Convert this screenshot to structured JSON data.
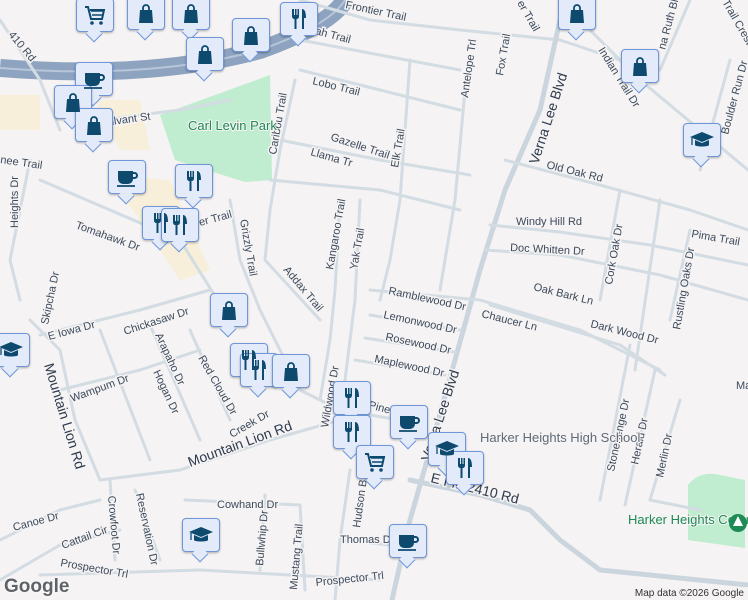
{
  "map": {
    "parks": [
      "Carl Levin Park",
      "Harker Heights Community Park"
    ],
    "poi": "Harker Heights High School",
    "roads": [
      "410 Rd",
      "Frontier Trail",
      "eetah Trail",
      "Lobo Trail",
      "Caribou Trail",
      "Gazelle Trail",
      "Llama Tr",
      "Elk Trail",
      "Antelope Trl",
      "Fox Trail",
      "er Trail",
      "Verna Lee Blvd",
      "Indian Trail Dr",
      "na Ruth Blvd",
      "Boulder Run Dr",
      "Trail Crest",
      "Old Oak Rd",
      "Windy Hill Rd",
      "Pima Trail",
      "Doc Whitten Dr",
      "Cork Oak Dr",
      "Rustling Oaks Dr",
      "Oak Bark Ln",
      "Ramblewood Dr",
      "Lemonwood Dr",
      "Chaucer Ln",
      "Dark Wood Dr",
      "Rosewood Dr",
      "Maplewood Dr",
      "Verna Lee Blvd",
      "E FM 2410 Rd",
      "Stonehenge Dr",
      "Herald Dr",
      "Merlin Dr",
      "Kangaroo Trail",
      "Yak Trail",
      "Addax Trail",
      "Grizzly Trail",
      "er Trail",
      "Tomahawk Dr",
      "Heights Dr",
      "nee Trail",
      "llvant St",
      "Skipcha Dr",
      "E Iowa Dr",
      "Chickasaw Dr",
      "Arapaho Dr",
      "Hogan Dr",
      "Red Cloud Dr",
      "Wampum Dr",
      "Mountain Lion Rd",
      "Creek Dr",
      "Mountain Lion Rd",
      "Cowhand Dr",
      "Bullwhip Dr",
      "Mustang Trail",
      "Crowfoot Dr",
      "Reservation Dr",
      "Canoe Dr",
      "Cattail Cir",
      "Prospector Trl",
      "Prospector Trl",
      "Hudson Blvd",
      "Thomas Dr",
      "Wildwood Dr",
      "Pinewood",
      "Ma"
    ],
    "markers": [
      "shopping-cart",
      "shopping-bag",
      "shopping-bag",
      "shopping-bag",
      "shopping-bag",
      "restaurant",
      "coffee",
      "shopping-bag",
      "shopping-bag",
      "coffee",
      "restaurant",
      "restaurant",
      "restaurant",
      "shopping-bag",
      "restaurant",
      "restaurant",
      "shopping-bag",
      "restaurant",
      "restaurant",
      "shopping-cart",
      "coffee",
      "school",
      "restaurant",
      "coffee",
      "school",
      "shopping-bag",
      "shopping-bag",
      "school",
      "school"
    ]
  },
  "branding": {
    "logo": "Google",
    "attribution": "Map data ©2026 Google"
  },
  "colors": {
    "marker_icon": "#0d4a6e",
    "marker_bg": "#e3ebfb",
    "park": "#c0ecd0",
    "highway": "#8da3bf"
  }
}
